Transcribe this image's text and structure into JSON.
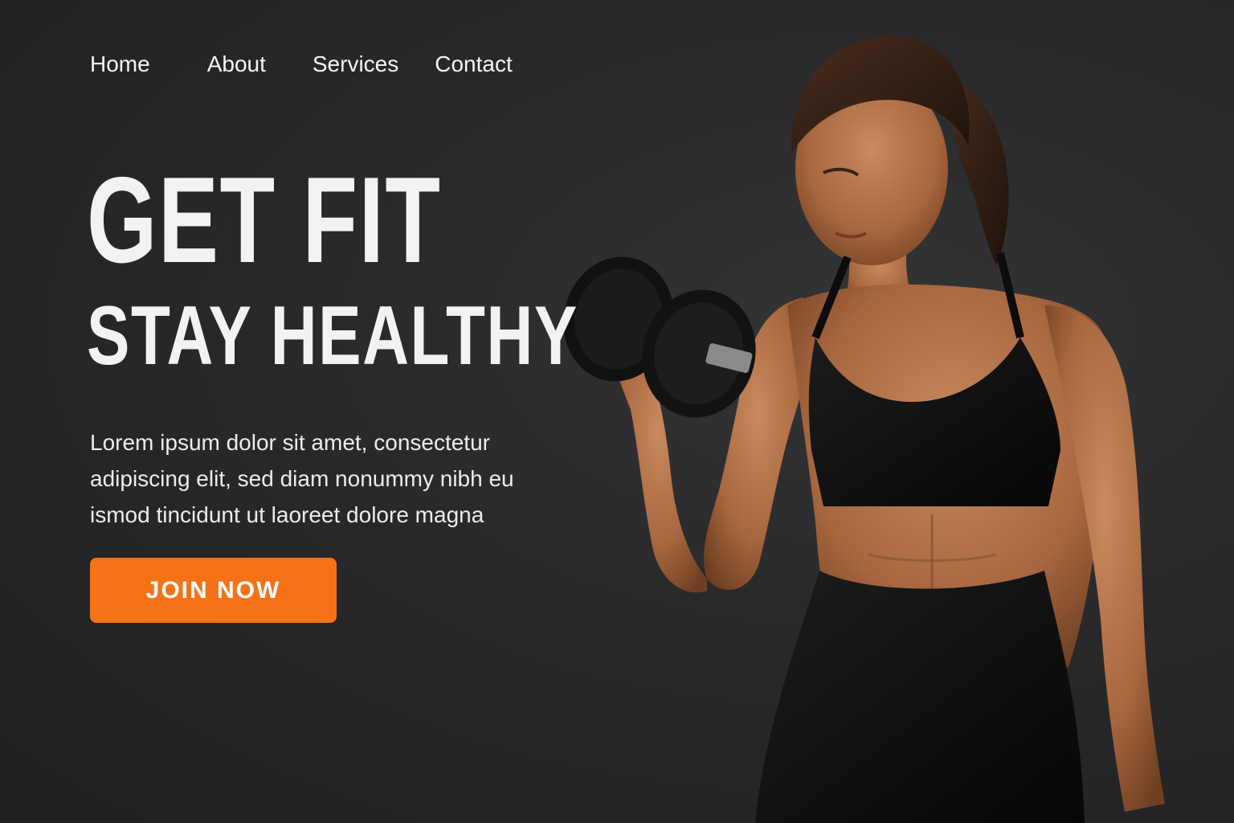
{
  "nav": {
    "items": [
      {
        "label": "Home"
      },
      {
        "label": "About"
      },
      {
        "label": "Services"
      },
      {
        "label": "Contact"
      }
    ]
  },
  "hero": {
    "title_line1": "GET FIT",
    "title_line2": "STAY HEALTHY",
    "description": "Lorem ipsum dolor sit amet, consectetur adipiscing elit, sed diam nonummy nibh eu ismod tincidunt ut laoreet dolore magna",
    "cta_label": "JOIN NOW"
  },
  "colors": {
    "background": "#262729",
    "accent": "#f57316",
    "text": "#ffffff"
  }
}
